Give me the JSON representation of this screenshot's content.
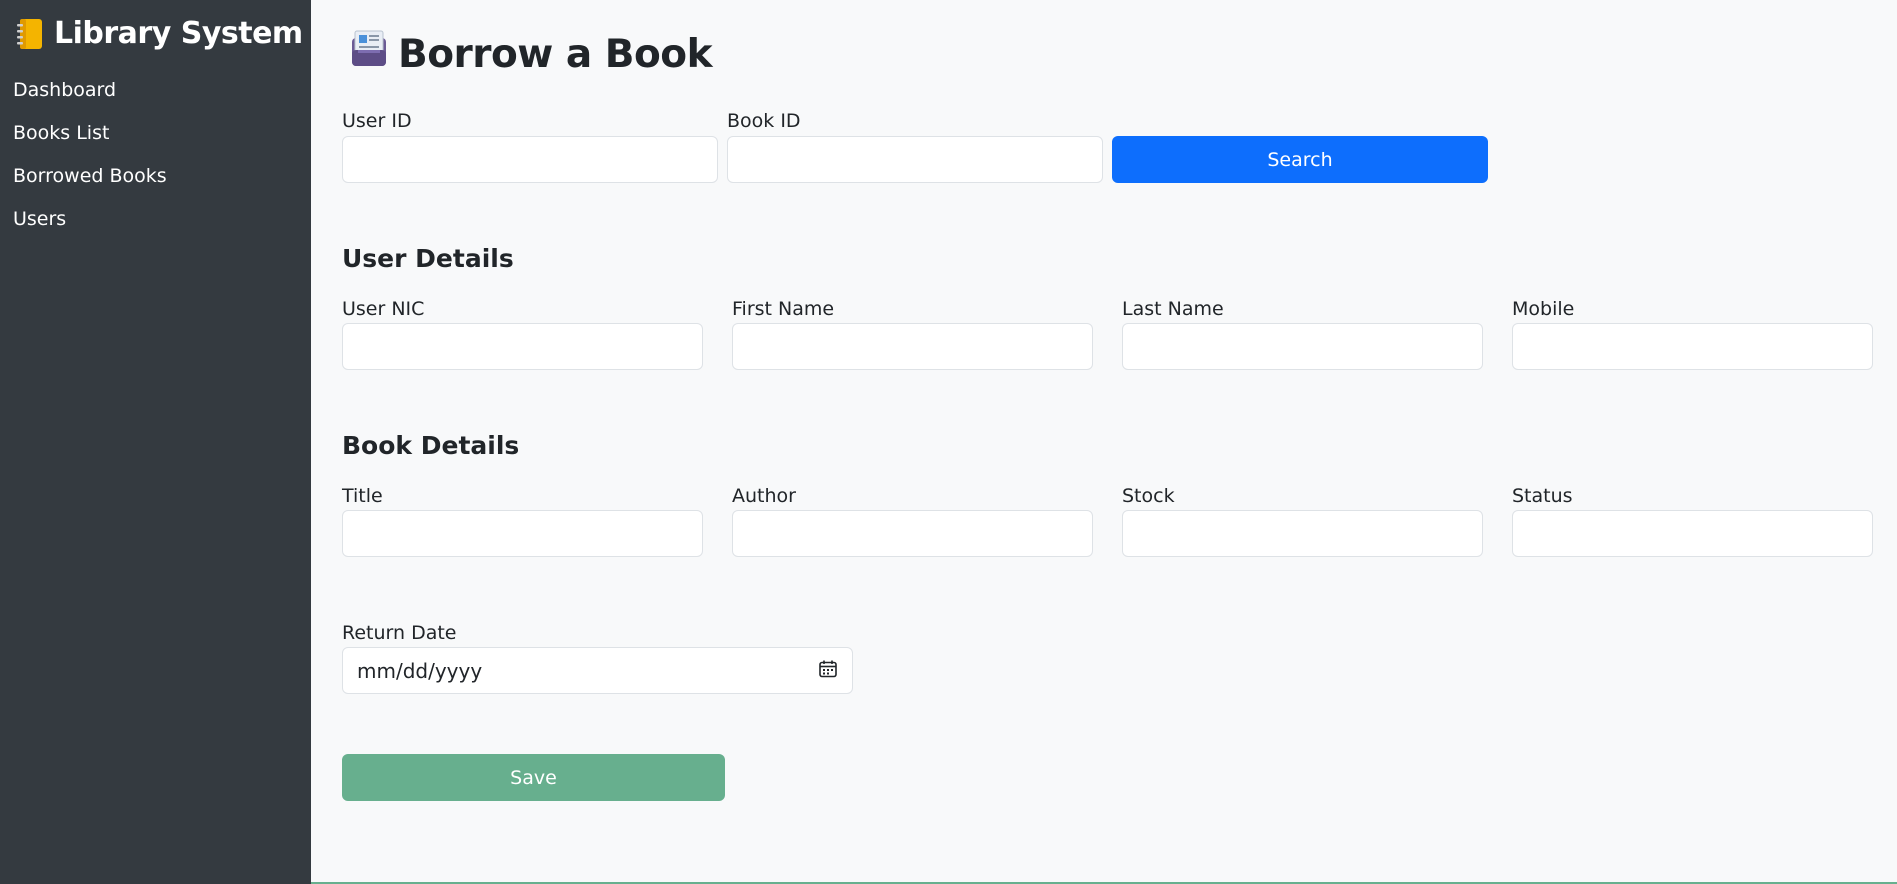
{
  "sidebar": {
    "brand": "Library System",
    "brand_icon": "notebook-icon",
    "items": [
      {
        "label": "Dashboard"
      },
      {
        "label": "Books List"
      },
      {
        "label": "Borrowed Books"
      },
      {
        "label": "Users"
      }
    ]
  },
  "page": {
    "title": "Borrow a Book",
    "title_icon": "book-icon"
  },
  "search": {
    "user_id_label": "User ID",
    "user_id_value": "",
    "book_id_label": "Book ID",
    "book_id_value": "",
    "button_label": "Search"
  },
  "user_details": {
    "heading": "User Details",
    "nic_label": "User NIC",
    "first_name_label": "First Name",
    "last_name_label": "Last Name",
    "mobile_label": "Mobile"
  },
  "book_details": {
    "heading": "Book Details",
    "title_label": "Title",
    "author_label": "Author",
    "stock_label": "Stock",
    "status_label": "Status"
  },
  "return_date": {
    "label": "Return Date",
    "placeholder": "mm/dd/yyyy",
    "icon": "calendar-icon"
  },
  "actions": {
    "save_label": "Save"
  },
  "colors": {
    "sidebar_bg": "#343a40",
    "primary": "#0d6efd",
    "save": "#67af8e",
    "page_bg": "#f8f9fa"
  }
}
